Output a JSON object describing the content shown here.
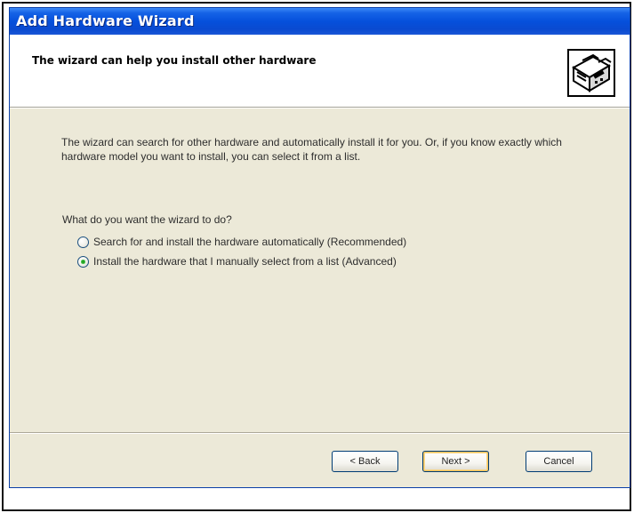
{
  "window": {
    "title": "Add Hardware Wizard"
  },
  "header": {
    "title": "The wizard can help you install other hardware",
    "icon": "hardware-icon"
  },
  "body": {
    "intro": "The wizard can search for other hardware and automatically install it for you. Or, if you know exactly which hardware model you want to install, you can select it from a list.",
    "question": "What do you want the wizard to do?",
    "options": [
      {
        "label": "Search for and install the hardware automatically (Recommended)",
        "selected": false
      },
      {
        "label": "Install the hardware that I manually select from a list (Advanced)",
        "selected": true
      }
    ]
  },
  "buttons": {
    "back": "< Back",
    "next": "Next >",
    "cancel": "Cancel"
  },
  "colors": {
    "titlebar": "#0550dc",
    "dialog_bg": "#ece9d8",
    "default_button_highlight": "#f2c35a",
    "radio_dot": "#21a121"
  }
}
